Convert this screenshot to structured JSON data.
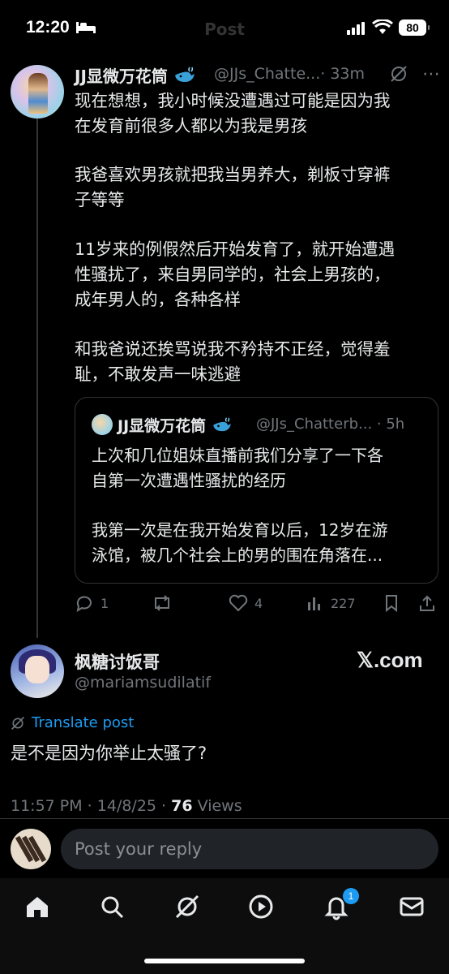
{
  "status_bar": {
    "time": "12:20",
    "battery": "80"
  },
  "header": {
    "title": "Post"
  },
  "main_post": {
    "name": "JJ显微万花筒",
    "handle": "@JJs_Chatte...",
    "separator_time": "· 33m",
    "paragraphs": [
      [
        "现在想想，我小时候没遭遇过可能是因为我",
        "在发育前很多人都以为我是男孩"
      ],
      [
        "我爸喜欢男孩就把我当男养大，剃板寸穿裤",
        "子等等"
      ],
      [
        "11岁来的例假然后开始发育了，就开始遭遇",
        "性骚扰了，来自男同学的，社会上男孩的，",
        "成年男人的，各种各样"
      ],
      [
        "和我爸说还挨骂说我不矜持不正经，觉得羞",
        "耻，不敢发声一味逃避"
      ]
    ],
    "quote": {
      "name": "JJ显微万花筒",
      "handle": "@JJs_Chatterb... · 5h",
      "lines": [
        "上次和几位姐妹直播前我们分享了一下各",
        "自第一次遭遇性骚扰的经历",
        "我第一次是在我开始发育以后，12岁在游",
        "泳馆，被几个社会上的男的围在角落在..."
      ]
    },
    "actions": {
      "replies": "1",
      "reposts": "",
      "likes": "4",
      "views": "227"
    }
  },
  "reply_post": {
    "name": "枫糖讨饭哥",
    "handle": "@mariamsudilatif",
    "watermark": "𝕏.com",
    "translate": "Translate post",
    "text": "是不是因为你举止太骚了?",
    "meta_time": "11:57 PM · 14/8/25 · ",
    "views_count": "76",
    "views_label": " Views"
  },
  "compose": {
    "placeholder": "Post your reply"
  },
  "nav": {
    "notifications_badge": "1"
  },
  "colors": {
    "accent": "#1d9bf0",
    "background": "#000000",
    "muted": "#71767b"
  },
  "icons": [
    "home-icon",
    "search-icon",
    "grok-icon",
    "video-icon",
    "bell-icon",
    "mail-icon",
    "reply-icon",
    "repost-icon",
    "heart-icon",
    "views-icon",
    "bookmark-icon",
    "share-icon"
  ]
}
